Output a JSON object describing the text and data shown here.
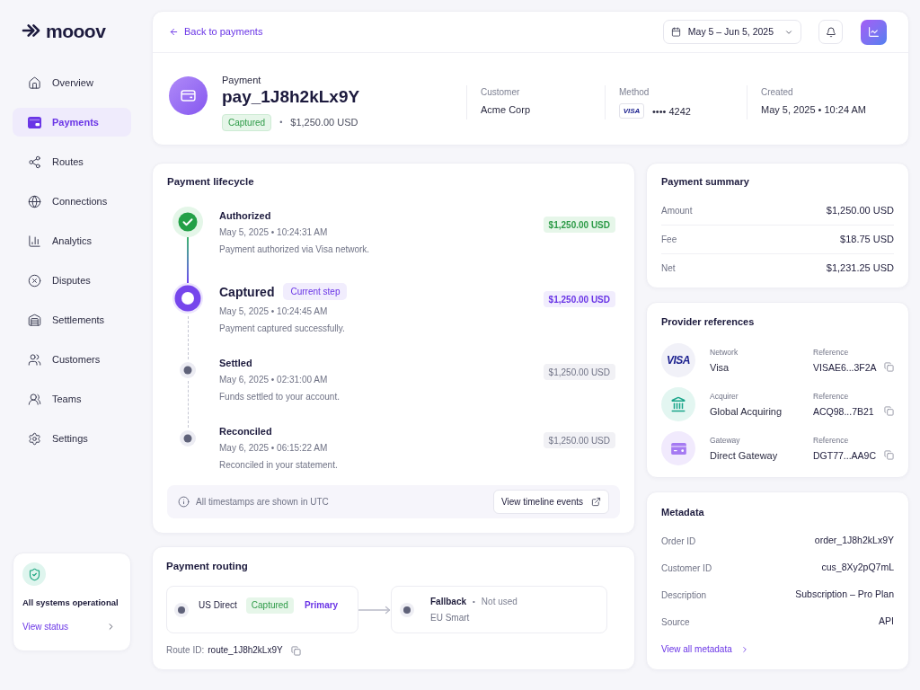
{
  "brand": {
    "name": "mooov"
  },
  "sidebar": {
    "items": [
      {
        "label": "Overview",
        "selected": false
      },
      {
        "label": "Payments",
        "selected": true
      },
      {
        "label": "Routes",
        "selected": false
      },
      {
        "label": "Connections",
        "selected": false
      },
      {
        "label": "Analytics",
        "selected": false
      },
      {
        "label": "Disputes",
        "selected": false
      },
      {
        "label": "Settlements",
        "selected": false
      },
      {
        "label": "Customers",
        "selected": false
      },
      {
        "label": "Teams",
        "selected": false
      },
      {
        "label": "Settings",
        "selected": false
      }
    ],
    "status_card": {
      "title": "All systems operational",
      "link": "View status"
    }
  },
  "top_bar": {
    "back_link": "Back to payments",
    "date_range": "May 5 – Jun 5, 2025"
  },
  "payment": {
    "label": "Payment",
    "id": "pay_1J8h2kLx9Y",
    "status": "Captured",
    "separator": "•",
    "amount": "$1,250.00 USD",
    "details": [
      {
        "kind": "text",
        "label": "Customer",
        "value": "Acme Corp"
      },
      {
        "kind": "card",
        "label": "Method",
        "brand": "VISA",
        "value": "•••• 4242"
      },
      {
        "kind": "text",
        "label": "Created",
        "value": "May 5, 2025 • 10:24 AM"
      }
    ]
  },
  "lifecycle": {
    "title": "Payment lifecycle",
    "steps": [
      {
        "title": "Authorized",
        "completed": true,
        "current": false,
        "time": "May 5, 2025 • 10:24:31 AM",
        "note": "Payment authorized via Visa network.",
        "amount": "$1,250.00 USD"
      },
      {
        "title": "Captured",
        "completed": false,
        "current": true,
        "badge": "Current step",
        "time": "May 5, 2025 • 10:24:45 AM",
        "note": "Payment captured successfully.",
        "amount": "$1,250.00 USD"
      },
      {
        "title": "Settled",
        "completed": false,
        "current": false,
        "time": "May 6, 2025 • 02:31:00 AM",
        "note": "Funds settled to your account.",
        "amount": "$1,250.00 USD"
      },
      {
        "title": "Reconciled",
        "completed": false,
        "current": false,
        "time": "May 6, 2025 • 06:15:22 AM",
        "note": "Reconciled in your statement.",
        "amount": "$1,250.00 USD"
      }
    ],
    "notice": "All timestamps are shown in UTC",
    "action": "View timeline events"
  },
  "routing": {
    "title": "Payment routing",
    "routes": [
      {
        "kind": "primary",
        "name": "US Direct",
        "status": "Captured",
        "role": "Primary"
      },
      {
        "kind": "fallback",
        "role": "Fallback",
        "separator": "•",
        "usage": "Not used",
        "name": "EU Smart"
      }
    ],
    "route_id_label": "Route ID:",
    "route_id": "route_1J8h2kLx9Y"
  },
  "summary": {
    "title": "Payment summary",
    "rows": [
      {
        "label": "Amount",
        "value": "$1,250.00 USD"
      },
      {
        "label": "Fee",
        "value": "$18.75 USD"
      },
      {
        "label": "Net",
        "value": "$1,231.25 USD"
      }
    ]
  },
  "providers": {
    "title": "Provider references",
    "items": [
      {
        "kind": "network",
        "logo": "VISA",
        "label": "Network",
        "name": "Visa",
        "reference_label": "Reference",
        "reference": "VISAE6...3F2A"
      },
      {
        "kind": "acquirer",
        "label": "Acquirer",
        "name": "Global Acquiring",
        "reference_label": "Reference",
        "reference": "ACQ98...7B21"
      },
      {
        "kind": "gateway",
        "label": "Gateway",
        "name": "Direct Gateway",
        "reference_label": "Reference",
        "reference": "DGT77...AA9C"
      }
    ]
  },
  "metadata": {
    "title": "Metadata",
    "rows": [
      {
        "label": "Order ID",
        "value": "order_1J8h2kLx9Y"
      },
      {
        "label": "Customer ID",
        "value": "cus_8Xy2pQ7mL"
      },
      {
        "label": "Description",
        "value": "Subscription – Pro Plan"
      },
      {
        "label": "Source",
        "value": "API"
      }
    ],
    "link": "View all metadata"
  }
}
